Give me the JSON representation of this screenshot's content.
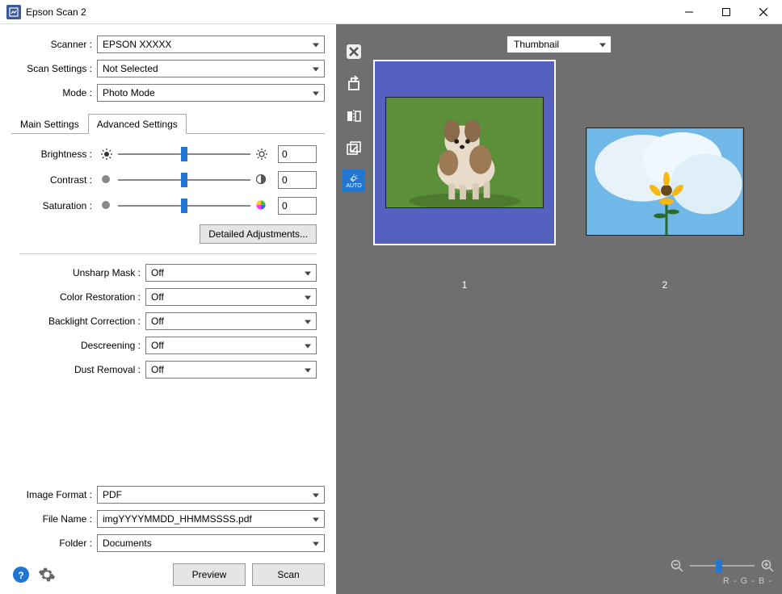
{
  "titlebar": {
    "title": "Epson Scan 2"
  },
  "top_form": {
    "scanner_label": "Scanner :",
    "scanner_value": "EPSON XXXXX",
    "scan_settings_label": "Scan Settings :",
    "scan_settings_value": "Not Selected",
    "mode_label": "Mode :",
    "mode_value": "Photo Mode"
  },
  "tabs": {
    "main": "Main Settings",
    "advanced": "Advanced Settings"
  },
  "sliders": {
    "brightness_label": "Brightness :",
    "brightness_value": "0",
    "contrast_label": "Contrast :",
    "contrast_value": "0",
    "saturation_label": "Saturation :",
    "saturation_value": "0"
  },
  "detailed_btn": "Detailed Adjustments...",
  "options": {
    "unsharp_label": "Unsharp Mask :",
    "unsharp_value": "Off",
    "color_restoration_label": "Color Restoration :",
    "color_restoration_value": "Off",
    "backlight_label": "Backlight Correction :",
    "backlight_value": "Off",
    "descreening_label": "Descreening :",
    "descreening_value": "Off",
    "dust_label": "Dust Removal :",
    "dust_value": "Off"
  },
  "bottom_form": {
    "image_format_label": "Image Format :",
    "image_format_value": "PDF",
    "file_name_label": "File Name :",
    "file_name_value": "imgYYYYMMDD_HHMMSSSS.pdf",
    "folder_label": "Folder :",
    "folder_value": "Documents"
  },
  "actions": {
    "preview": "Preview",
    "scan": "Scan"
  },
  "preview": {
    "view_mode": "Thumbnail",
    "auto_label": "AUTO",
    "thumb1_num": "1",
    "thumb2_num": "2",
    "rgb": "R   -     G   -     B   -"
  }
}
